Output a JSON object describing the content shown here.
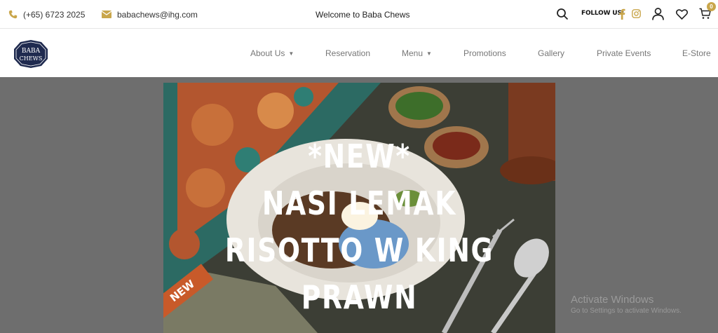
{
  "topbar": {
    "phone": "(+65) 6723 2025",
    "email": "babachews@ihg.com",
    "welcome": "Welcome to Baba Chews",
    "follow_label": "FOLLOW US:",
    "cart_count": "0"
  },
  "logo": {
    "line1": "BABA",
    "line2": "CHEWS"
  },
  "nav": {
    "about": "About Us",
    "reservation": "Reservation",
    "menu": "Menu",
    "promotions": "Promotions",
    "gallery": "Gallery",
    "private_events": "Private Events",
    "estore": "E-Store"
  },
  "hero": {
    "lines": [
      "*NEW*",
      "NASI LEMAK",
      "RISOTTO W KING",
      "PRAWN"
    ],
    "ribbon": "NEW"
  },
  "watermark": {
    "title": "Activate Windows",
    "subtitle": "Go to Settings to activate Windows."
  },
  "colors": {
    "accent": "#c9a64b",
    "overlay": "#6e6e6e",
    "brand_navy": "#1f2a4f"
  }
}
